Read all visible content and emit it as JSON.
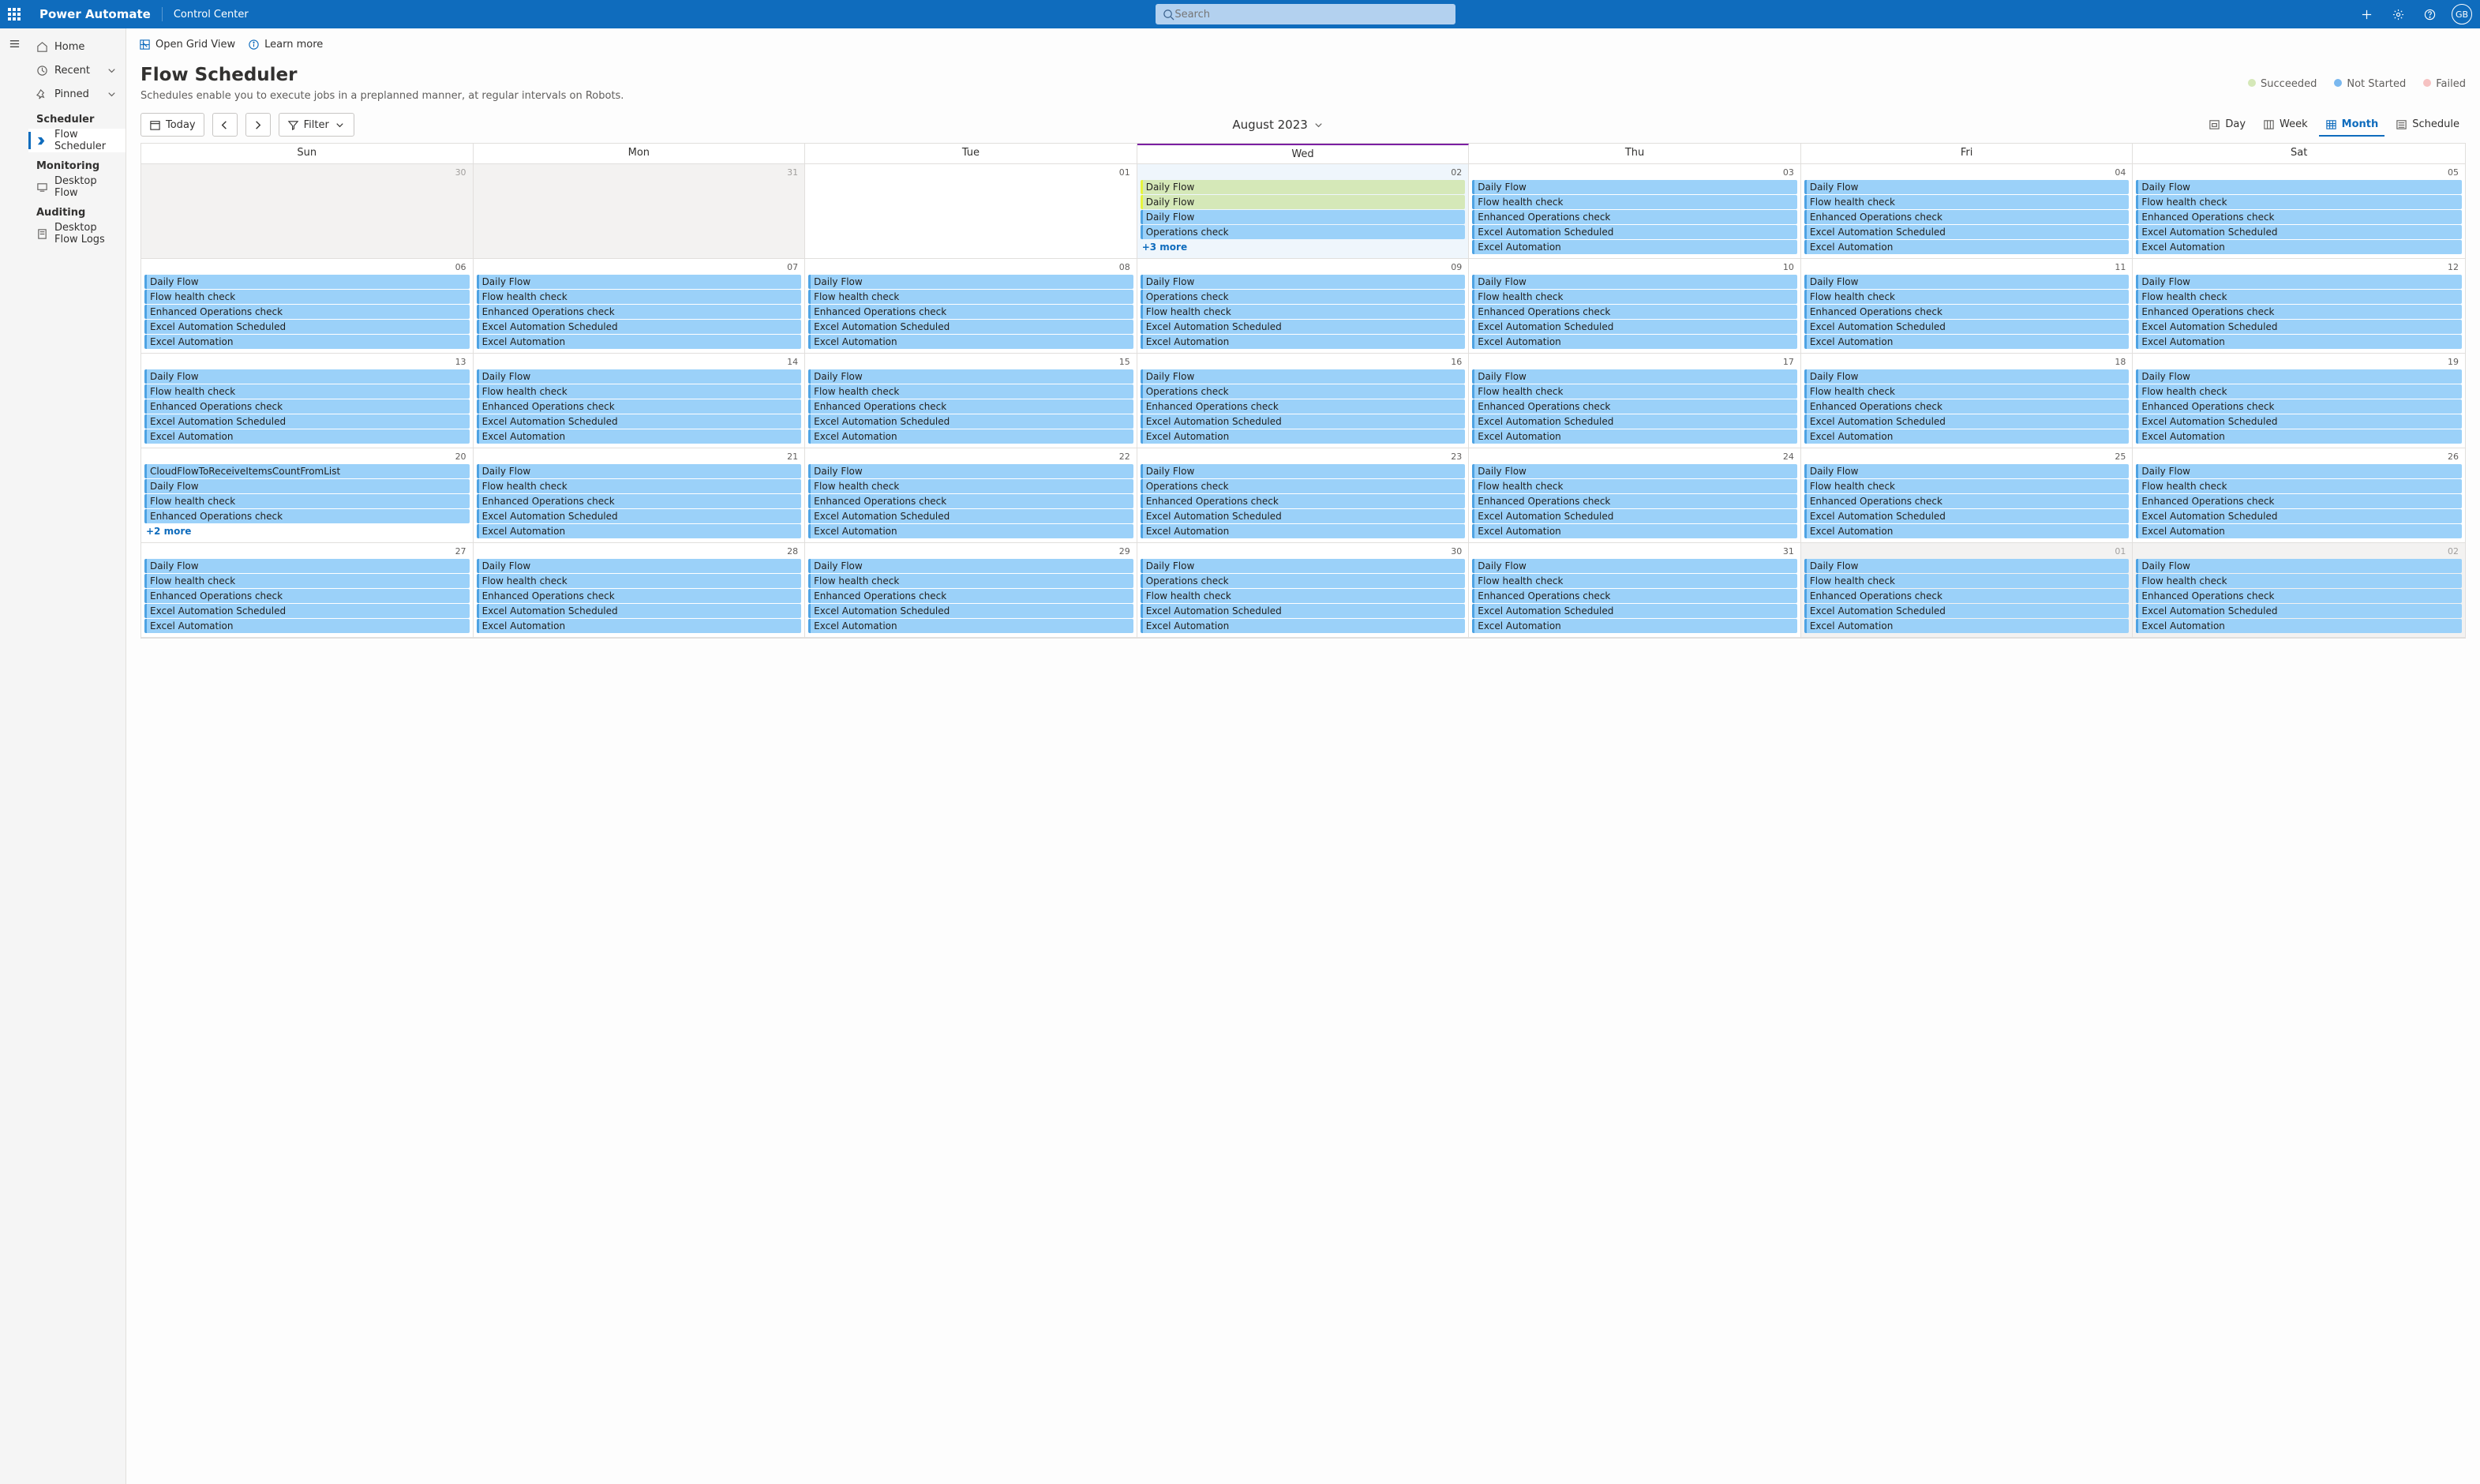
{
  "header": {
    "brand": "Power Automate",
    "page": "Control Center",
    "search_placeholder": "Search",
    "avatar_initials": "GB"
  },
  "sidebar": {
    "home": "Home",
    "recent": "Recent",
    "pinned": "Pinned",
    "sect_scheduler": "Scheduler",
    "flow_scheduler": "Flow Scheduler",
    "sect_monitoring": "Monitoring",
    "desktop_flow": "Desktop Flow",
    "sect_auditing": "Auditing",
    "desktop_flow_logs": "Desktop Flow Logs"
  },
  "commands": {
    "open_grid": "Open Grid View",
    "learn_more": "Learn more"
  },
  "page": {
    "title": "Flow Scheduler",
    "subtitle": "Schedules enable you to execute jobs in a preplanned manner, at regular intervals on Robots."
  },
  "legend": {
    "succeeded": {
      "label": "Succeeded",
      "color": "#d5e8b8"
    },
    "not_started": {
      "label": "Not Started",
      "color": "#7ab8ef"
    },
    "failed": {
      "label": "Failed",
      "color": "#f6c2c2"
    }
  },
  "toolbar": {
    "today": "Today",
    "filter": "Filter",
    "month_label": "August 2023",
    "views": {
      "day": "Day",
      "week": "Week",
      "month": "Month",
      "schedule": "Schedule"
    }
  },
  "calendar": {
    "day_headers": [
      "Sun",
      "Mon",
      "Tue",
      "Wed",
      "Thu",
      "Fri",
      "Sat"
    ],
    "today_col_index": 3,
    "cells": [
      {
        "d": "30",
        "off": true,
        "ev": []
      },
      {
        "d": "31",
        "off": true,
        "ev": []
      },
      {
        "d": "01",
        "ev": []
      },
      {
        "d": "02",
        "today": true,
        "ev": [
          {
            "t": "Daily Flow",
            "s": true
          },
          {
            "t": "Daily Flow",
            "s": true
          },
          {
            "t": "Daily Flow"
          },
          {
            "t": "Operations check"
          }
        ],
        "more": "+3 more"
      },
      {
        "d": "03",
        "ev": [
          {
            "t": "Daily Flow"
          },
          {
            "t": "Flow health check"
          },
          {
            "t": "Enhanced Operations check"
          },
          {
            "t": "Excel Automation Scheduled"
          },
          {
            "t": "Excel Automation"
          }
        ]
      },
      {
        "d": "04",
        "ev": [
          {
            "t": "Daily Flow"
          },
          {
            "t": "Flow health check"
          },
          {
            "t": "Enhanced Operations check"
          },
          {
            "t": "Excel Automation Scheduled"
          },
          {
            "t": "Excel Automation"
          }
        ]
      },
      {
        "d": "05",
        "ev": [
          {
            "t": "Daily Flow"
          },
          {
            "t": "Flow health check"
          },
          {
            "t": "Enhanced Operations check"
          },
          {
            "t": "Excel Automation Scheduled"
          },
          {
            "t": "Excel Automation"
          }
        ]
      },
      {
        "d": "06",
        "ev": [
          {
            "t": "Daily Flow"
          },
          {
            "t": "Flow health check"
          },
          {
            "t": "Enhanced Operations check"
          },
          {
            "t": "Excel Automation Scheduled"
          },
          {
            "t": "Excel Automation"
          }
        ]
      },
      {
        "d": "07",
        "ev": [
          {
            "t": "Daily Flow"
          },
          {
            "t": "Flow health check"
          },
          {
            "t": "Enhanced Operations check"
          },
          {
            "t": "Excel Automation Scheduled"
          },
          {
            "t": "Excel Automation"
          }
        ]
      },
      {
        "d": "08",
        "ev": [
          {
            "t": "Daily Flow"
          },
          {
            "t": "Flow health check"
          },
          {
            "t": "Enhanced Operations check"
          },
          {
            "t": "Excel Automation Scheduled"
          },
          {
            "t": "Excel Automation"
          }
        ]
      },
      {
        "d": "09",
        "ev": [
          {
            "t": "Daily Flow"
          },
          {
            "t": "Operations check"
          },
          {
            "t": "Flow health check"
          },
          {
            "t": "Excel Automation Scheduled"
          },
          {
            "t": "Excel Automation"
          }
        ]
      },
      {
        "d": "10",
        "ev": [
          {
            "t": "Daily Flow"
          },
          {
            "t": "Flow health check"
          },
          {
            "t": "Enhanced Operations check"
          },
          {
            "t": "Excel Automation Scheduled"
          },
          {
            "t": "Excel Automation"
          }
        ]
      },
      {
        "d": "11",
        "ev": [
          {
            "t": "Daily Flow"
          },
          {
            "t": "Flow health check"
          },
          {
            "t": "Enhanced Operations check"
          },
          {
            "t": "Excel Automation Scheduled"
          },
          {
            "t": "Excel Automation"
          }
        ]
      },
      {
        "d": "12",
        "ev": [
          {
            "t": "Daily Flow"
          },
          {
            "t": "Flow health check"
          },
          {
            "t": "Enhanced Operations check"
          },
          {
            "t": "Excel Automation Scheduled"
          },
          {
            "t": "Excel Automation"
          }
        ]
      },
      {
        "d": "13",
        "ev": [
          {
            "t": "Daily Flow"
          },
          {
            "t": "Flow health check"
          },
          {
            "t": "Enhanced Operations check"
          },
          {
            "t": "Excel Automation Scheduled"
          },
          {
            "t": "Excel Automation"
          }
        ]
      },
      {
        "d": "14",
        "ev": [
          {
            "t": "Daily Flow"
          },
          {
            "t": "Flow health check"
          },
          {
            "t": "Enhanced Operations check"
          },
          {
            "t": "Excel Automation Scheduled"
          },
          {
            "t": "Excel Automation"
          }
        ]
      },
      {
        "d": "15",
        "ev": [
          {
            "t": "Daily Flow"
          },
          {
            "t": "Flow health check"
          },
          {
            "t": "Enhanced Operations check"
          },
          {
            "t": "Excel Automation Scheduled"
          },
          {
            "t": "Excel Automation"
          }
        ]
      },
      {
        "d": "16",
        "ev": [
          {
            "t": "Daily Flow"
          },
          {
            "t": "Operations check"
          },
          {
            "t": "Enhanced Operations check"
          },
          {
            "t": "Excel Automation Scheduled"
          },
          {
            "t": "Excel Automation"
          }
        ]
      },
      {
        "d": "17",
        "ev": [
          {
            "t": "Daily Flow"
          },
          {
            "t": "Flow health check"
          },
          {
            "t": "Enhanced Operations check"
          },
          {
            "t": "Excel Automation Scheduled"
          },
          {
            "t": "Excel Automation"
          }
        ]
      },
      {
        "d": "18",
        "ev": [
          {
            "t": "Daily Flow"
          },
          {
            "t": "Flow health check"
          },
          {
            "t": "Enhanced Operations check"
          },
          {
            "t": "Excel Automation Scheduled"
          },
          {
            "t": "Excel Automation"
          }
        ]
      },
      {
        "d": "19",
        "ev": [
          {
            "t": "Daily Flow"
          },
          {
            "t": "Flow health check"
          },
          {
            "t": "Enhanced Operations check"
          },
          {
            "t": "Excel Automation Scheduled"
          },
          {
            "t": "Excel Automation"
          }
        ]
      },
      {
        "d": "20",
        "ev": [
          {
            "t": "CloudFlowToReceiveItemsCountFromList"
          },
          {
            "t": "Daily Flow"
          },
          {
            "t": "Flow health check"
          },
          {
            "t": "Enhanced Operations check"
          }
        ],
        "more": "+2 more"
      },
      {
        "d": "21",
        "ev": [
          {
            "t": "Daily Flow"
          },
          {
            "t": "Flow health check"
          },
          {
            "t": "Enhanced Operations check"
          },
          {
            "t": "Excel Automation Scheduled"
          },
          {
            "t": "Excel Automation"
          }
        ]
      },
      {
        "d": "22",
        "ev": [
          {
            "t": "Daily Flow"
          },
          {
            "t": "Flow health check"
          },
          {
            "t": "Enhanced Operations check"
          },
          {
            "t": "Excel Automation Scheduled"
          },
          {
            "t": "Excel Automation"
          }
        ]
      },
      {
        "d": "23",
        "ev": [
          {
            "t": "Daily Flow"
          },
          {
            "t": "Operations check"
          },
          {
            "t": "Enhanced Operations check"
          },
          {
            "t": "Excel Automation Scheduled"
          },
          {
            "t": "Excel Automation"
          }
        ]
      },
      {
        "d": "24",
        "ev": [
          {
            "t": "Daily Flow"
          },
          {
            "t": "Flow health check"
          },
          {
            "t": "Enhanced Operations check"
          },
          {
            "t": "Excel Automation Scheduled"
          },
          {
            "t": "Excel Automation"
          }
        ]
      },
      {
        "d": "25",
        "ev": [
          {
            "t": "Daily Flow"
          },
          {
            "t": "Flow health check"
          },
          {
            "t": "Enhanced Operations check"
          },
          {
            "t": "Excel Automation Scheduled"
          },
          {
            "t": "Excel Automation"
          }
        ]
      },
      {
        "d": "26",
        "ev": [
          {
            "t": "Daily Flow"
          },
          {
            "t": "Flow health check"
          },
          {
            "t": "Enhanced Operations check"
          },
          {
            "t": "Excel Automation Scheduled"
          },
          {
            "t": "Excel Automation"
          }
        ]
      },
      {
        "d": "27",
        "ev": [
          {
            "t": "Daily Flow"
          },
          {
            "t": "Flow health check"
          },
          {
            "t": "Enhanced Operations check"
          },
          {
            "t": "Excel Automation Scheduled"
          },
          {
            "t": "Excel Automation"
          }
        ]
      },
      {
        "d": "28",
        "ev": [
          {
            "t": "Daily Flow"
          },
          {
            "t": "Flow health check"
          },
          {
            "t": "Enhanced Operations check"
          },
          {
            "t": "Excel Automation Scheduled"
          },
          {
            "t": "Excel Automation"
          }
        ]
      },
      {
        "d": "29",
        "ev": [
          {
            "t": "Daily Flow"
          },
          {
            "t": "Flow health check"
          },
          {
            "t": "Enhanced Operations check"
          },
          {
            "t": "Excel Automation Scheduled"
          },
          {
            "t": "Excel Automation"
          }
        ]
      },
      {
        "d": "30",
        "ev": [
          {
            "t": "Daily Flow"
          },
          {
            "t": "Operations check"
          },
          {
            "t": "Flow health check"
          },
          {
            "t": "Excel Automation Scheduled"
          },
          {
            "t": "Excel Automation"
          }
        ]
      },
      {
        "d": "31",
        "ev": [
          {
            "t": "Daily Flow"
          },
          {
            "t": "Flow health check"
          },
          {
            "t": "Enhanced Operations check"
          },
          {
            "t": "Excel Automation Scheduled"
          },
          {
            "t": "Excel Automation"
          }
        ]
      },
      {
        "d": "01",
        "off": true,
        "ev": [
          {
            "t": "Daily Flow"
          },
          {
            "t": "Flow health check"
          },
          {
            "t": "Enhanced Operations check"
          },
          {
            "t": "Excel Automation Scheduled"
          },
          {
            "t": "Excel Automation"
          }
        ]
      },
      {
        "d": "02",
        "off": true,
        "ev": [
          {
            "t": "Daily Flow"
          },
          {
            "t": "Flow health check"
          },
          {
            "t": "Enhanced Operations check"
          },
          {
            "t": "Excel Automation Scheduled"
          },
          {
            "t": "Excel Automation"
          }
        ]
      }
    ]
  }
}
